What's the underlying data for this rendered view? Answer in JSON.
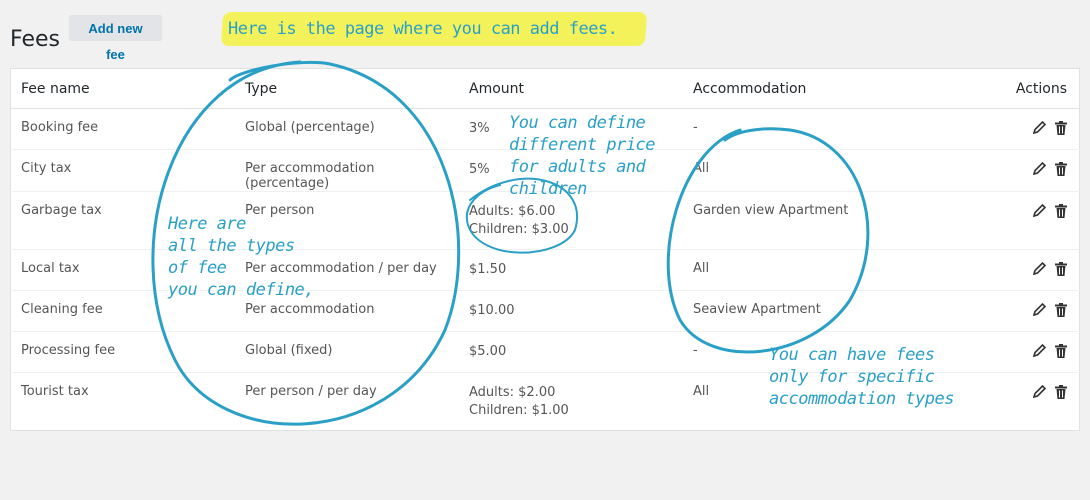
{
  "page": {
    "title": "Fees",
    "add_button": "Add new fee"
  },
  "table": {
    "headers": {
      "name": "Fee name",
      "type": "Type",
      "amount": "Amount",
      "accommodation": "Accommodation",
      "actions": "Actions"
    },
    "rows": [
      {
        "name": "Booking fee",
        "type": "Global (percentage)",
        "amount": [
          "3%"
        ],
        "accommodation": "-"
      },
      {
        "name": "City tax",
        "type": "Per accommodation (percentage)",
        "amount": [
          "5%"
        ],
        "accommodation": "All"
      },
      {
        "name": "Garbage tax",
        "type": "Per person",
        "amount": [
          "Adults: $6.00",
          "Children: $3.00"
        ],
        "accommodation": "Garden view Apartment"
      },
      {
        "name": "Local tax",
        "type": "Per accommodation / per day",
        "amount": [
          "$1.50"
        ],
        "accommodation": "All"
      },
      {
        "name": "Cleaning fee",
        "type": "Per accommodation",
        "amount": [
          "$10.00"
        ],
        "accommodation": "Seaview Apartment"
      },
      {
        "name": "Processing fee",
        "type": "Global (fixed)",
        "amount": [
          "$5.00"
        ],
        "accommodation": "-"
      },
      {
        "name": "Tourist tax",
        "type": "Per person / per day",
        "amount": [
          "Adults: $2.00",
          "Children: $1.00"
        ],
        "accommodation": "All"
      }
    ],
    "row_action_icons": [
      "pencil-icon",
      "trash-icon"
    ]
  },
  "annotations": {
    "top": "Here is the page where you can add fees.",
    "types": [
      "Here are",
      "all the types",
      "of fee",
      "you can define,"
    ],
    "amount": [
      "You can define",
      "different price",
      "for adults and",
      "children"
    ],
    "accommodation": [
      "You can have fees",
      "only for specific",
      "accommodation types"
    ]
  },
  "colors": {
    "annotation": "#2aa0c6",
    "highlight": "#f3f24a",
    "link": "#0073aa",
    "background": "#f1f1f1"
  }
}
